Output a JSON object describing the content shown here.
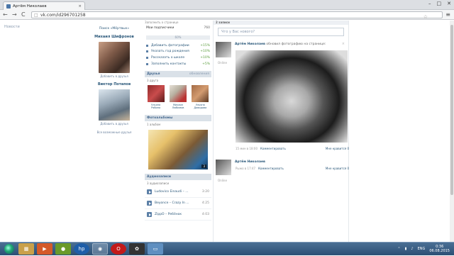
{
  "browser": {
    "tab_title": "Артём Николаев",
    "tab_close": "×",
    "url": "vk.com/id296701258",
    "win_min": "–",
    "win_max": "□",
    "win_close": "✕",
    "back": "←",
    "forward": "→",
    "reload": "C",
    "menu": "≡",
    "star": "☆",
    "lock": "□"
  },
  "left_nav": {
    "item": "Новости"
  },
  "left_col": {
    "search_link": "Поиск «Мёртвых»",
    "friends": [
      {
        "name": "Михаил Шифронов",
        "add": "Добавить в друзья"
      },
      {
        "name": "Виктор Потапов",
        "add": "Добавить в друзья"
      }
    ],
    "all_label": "Все возможные друзья"
  },
  "middle": {
    "top_crumb": "Заполнить о странице",
    "subscribers_label": "Мои подписчики",
    "subscribers_count": "760",
    "progress_label": "60%",
    "progress_fraction": 0.6,
    "tasks": [
      {
        "label": "Добавить фотографии",
        "pct": "+15%"
      },
      {
        "label": "Указать год рождения",
        "pct": "+10%"
      },
      {
        "label": "Рассказать о школе",
        "pct": "+10%"
      },
      {
        "label": "Заполнить контакты",
        "pct": "+5%"
      }
    ],
    "friends_title": "Друзья",
    "friends_right": "обновления",
    "friends_count": "3 друга",
    "friend_thumbs": [
      {
        "name": "Ульяна Рябина"
      },
      {
        "name": "Михаил Любимов"
      },
      {
        "name": "Ульяна Довидова"
      }
    ],
    "albums_title": "Фотоальбомы",
    "albums_count": "1 альбом",
    "album_photo_count": "3",
    "audio_title": "Аудиозаписи",
    "audio_count": "3 аудиозаписи",
    "audios": [
      {
        "title": "Ludovico Einaudi – ...",
        "duration": "3:20"
      },
      {
        "title": "Beyonce – Crazy In ...",
        "duration": "4:25"
      },
      {
        "title": "ZippO – Ребёнок",
        "duration": "4:03"
      }
    ]
  },
  "wall": {
    "header": "2 записи",
    "new_post_placeholder": "Что у Вас нового?",
    "post1": {
      "author": "Артём Николаев",
      "status": "обновил фотографию на странице:",
      "online": "Online",
      "date": "15 мин в 18:00",
      "comment": "Комментировать",
      "likes": "Мне нравится",
      "like_count": "0",
      "close": "×"
    },
    "post2": {
      "author": "Артём Николаев",
      "date": "Рыжо в 17:47",
      "comment": "Комментировать",
      "online": "Online",
      "likes": "Мне нравится",
      "like_count": "0"
    }
  },
  "taskbar": {
    "lang": "ENG",
    "time": "0:36",
    "date": "06.08.2015",
    "tray_icons": [
      "⌃",
      "▮",
      "♪"
    ],
    "apps": [
      {
        "icon": "folder-icon",
        "glyph": "▦"
      },
      {
        "icon": "media-icon",
        "glyph": "▶"
      },
      {
        "icon": "winamp-icon",
        "glyph": "●"
      },
      {
        "icon": "hp-icon",
        "glyph": "hp"
      },
      {
        "icon": "chrome-icon",
        "glyph": "◉"
      },
      {
        "icon": "opera-icon",
        "glyph": "O"
      },
      {
        "icon": "camera-icon",
        "glyph": "✿"
      },
      {
        "icon": "window-icon",
        "glyph": "▭"
      }
    ]
  }
}
